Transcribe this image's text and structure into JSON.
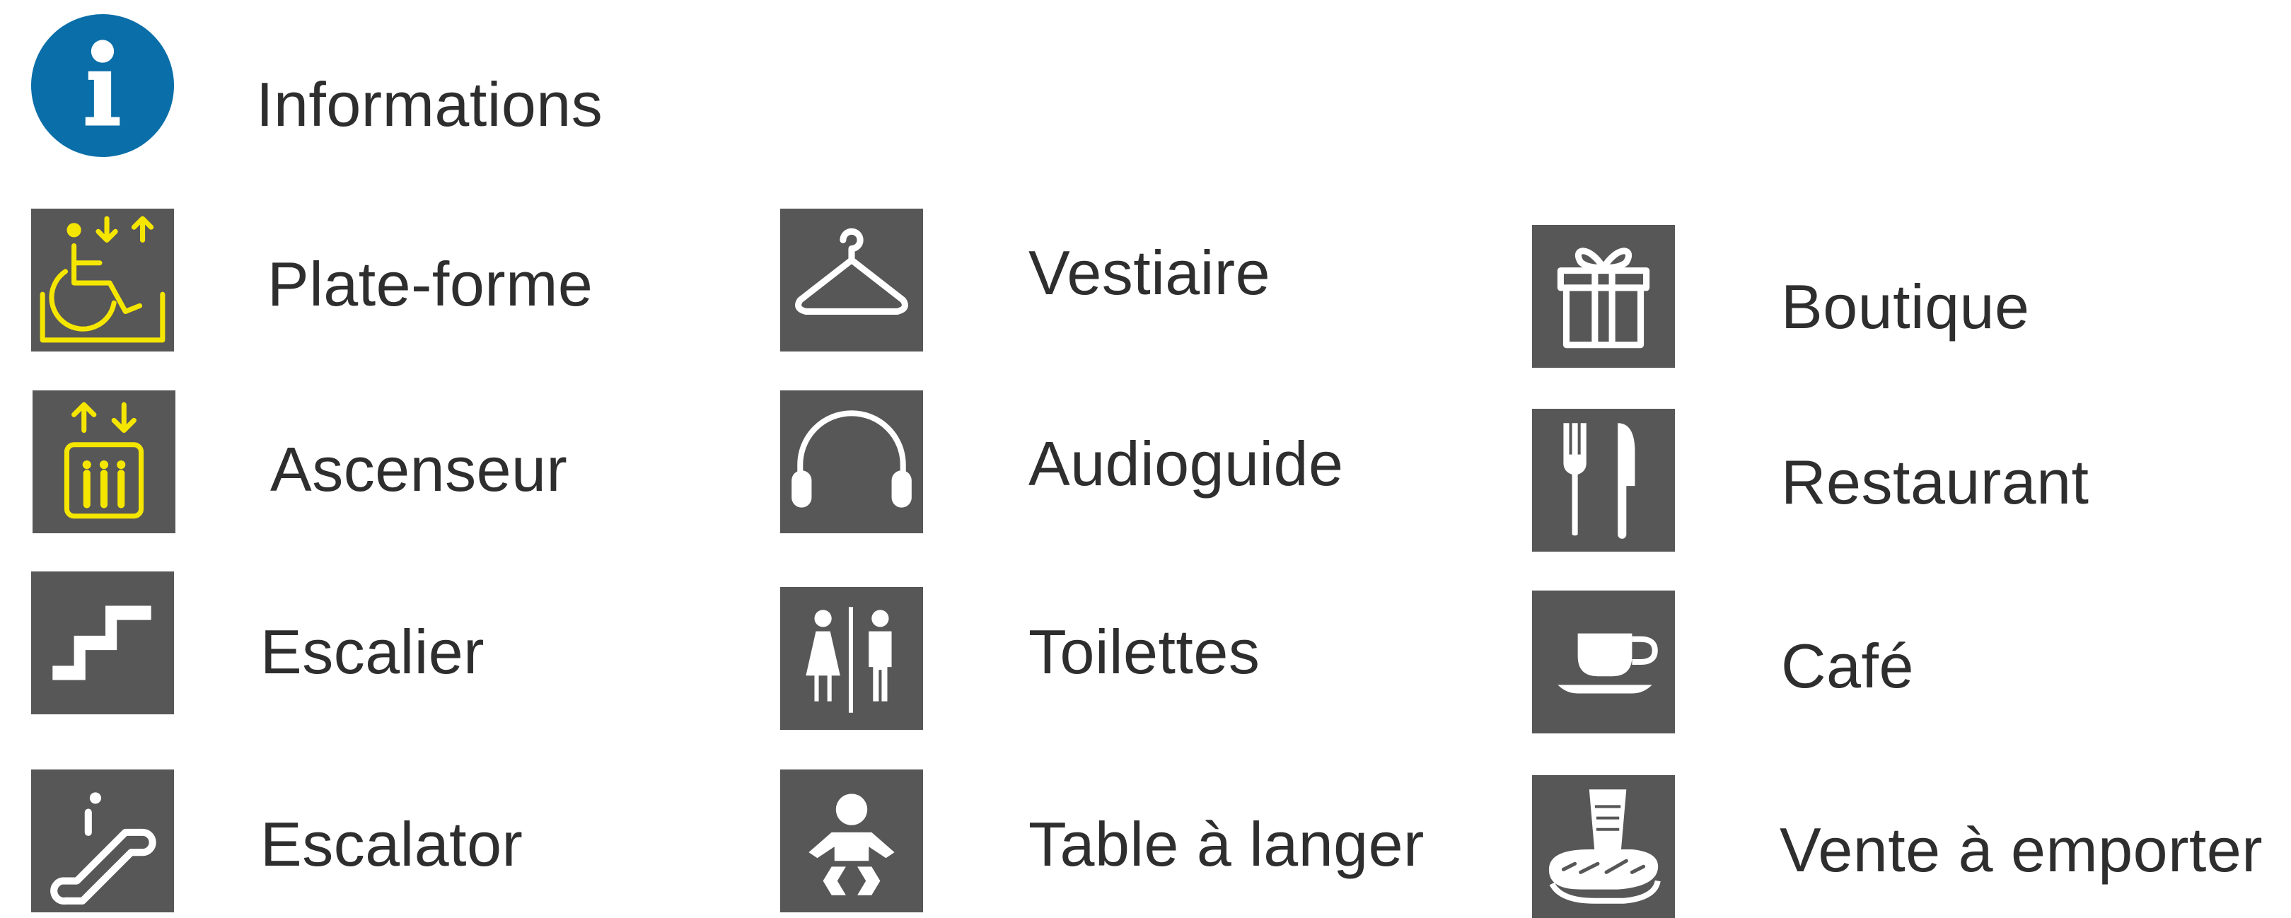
{
  "legend": {
    "info": {
      "label": "Informations",
      "icon": "info-icon",
      "color": "#0a6ea8"
    },
    "items": [
      {
        "label": "Plate-forme",
        "icon": "wheelchair-platform-icon",
        "color": "#f5e600"
      },
      {
        "label": "Ascenseur",
        "icon": "elevator-icon",
        "color": "#f5e600"
      },
      {
        "label": "Escalier",
        "icon": "stairs-icon"
      },
      {
        "label": "Escalator",
        "icon": "escalator-icon"
      },
      {
        "label": "Vestiaire",
        "icon": "coat-hanger-icon"
      },
      {
        "label": "Audioguide",
        "icon": "headphones-icon"
      },
      {
        "label": "Toilettes",
        "icon": "toilets-icon"
      },
      {
        "label": "Table à langer",
        "icon": "baby-changing-icon"
      },
      {
        "label": "Boutique",
        "icon": "gift-icon"
      },
      {
        "label": "Restaurant",
        "icon": "fork-knife-icon"
      },
      {
        "label": "Café",
        "icon": "coffee-cup-icon"
      },
      {
        "label": "Vente à emporter",
        "icon": "takeaway-icon"
      }
    ],
    "icon_background": "#575757"
  }
}
